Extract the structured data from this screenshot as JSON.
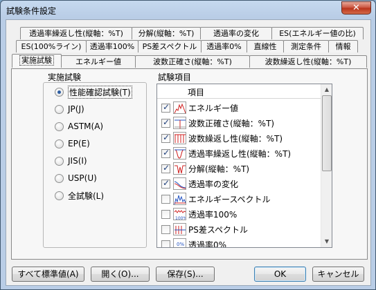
{
  "window": {
    "title": "試験条件設定",
    "close_glyph": "✕"
  },
  "tabs": {
    "row1": [
      "透過率繰返し性(縦軸：%T)",
      "分解(縦軸：%T)",
      "透過率の変化",
      "ES(エネルギー値の比)"
    ],
    "row2": [
      "ES(100%ライン)",
      "透過率100%",
      "PS差スペクトル",
      "透過率0%",
      "直線性",
      "測定条件",
      "情報"
    ],
    "row3": [
      "実施試験",
      "エネルギー値",
      "波数正確さ(縦軸：%T)",
      "波数繰返し性(縦軸：%T)"
    ],
    "active": "実施試験"
  },
  "left_group": {
    "label": "実施試験",
    "options": [
      {
        "label": "性能確認試験(T)",
        "selected": true
      },
      {
        "label": "JP(J)",
        "selected": false
      },
      {
        "label": "ASTM(A)",
        "selected": false
      },
      {
        "label": "EP(E)",
        "selected": false
      },
      {
        "label": "JIS(I)",
        "selected": false
      },
      {
        "label": "USP(U)",
        "selected": false
      },
      {
        "label": "全試験(L)",
        "selected": false
      }
    ]
  },
  "right_group": {
    "label": "試験項目",
    "column_header": "項目",
    "items": [
      {
        "label": "エネルギー値",
        "checked": true,
        "icon": "energy-spectrum-icon"
      },
      {
        "label": "波数正確さ(縦軸：%T)",
        "checked": true,
        "icon": "wavenumber-accuracy-icon"
      },
      {
        "label": "波数繰返し性(縦軸：%T)",
        "checked": true,
        "icon": "wavenumber-repeat-icon"
      },
      {
        "label": "透過率繰返し性(縦軸：%T)",
        "checked": true,
        "icon": "transmittance-repeat-icon"
      },
      {
        "label": "分解(縦軸：%T)",
        "checked": true,
        "icon": "resolution-icon"
      },
      {
        "label": "透過率の変化",
        "checked": true,
        "icon": "transmittance-change-icon"
      },
      {
        "label": "エネルギースペクトル",
        "checked": false,
        "icon": "energy-spectrum-es-icon"
      },
      {
        "label": "透過率100%",
        "checked": false,
        "icon": "transmittance-100-icon"
      },
      {
        "label": "PS差スペクトル",
        "checked": false,
        "icon": "ps-diff-icon"
      },
      {
        "label": "透過率0%",
        "checked": false,
        "icon": "transmittance-0-icon"
      }
    ]
  },
  "buttons": {
    "defaults": "すべて標準値(A)",
    "open": "開く(O)...",
    "save": "保存(S)...",
    "ok": "OK",
    "cancel": "キャンセル"
  },
  "colors": {
    "accent": "#2e5ea2",
    "spectrum_red": "#d02020",
    "spectrum_blue": "#2050c0"
  }
}
